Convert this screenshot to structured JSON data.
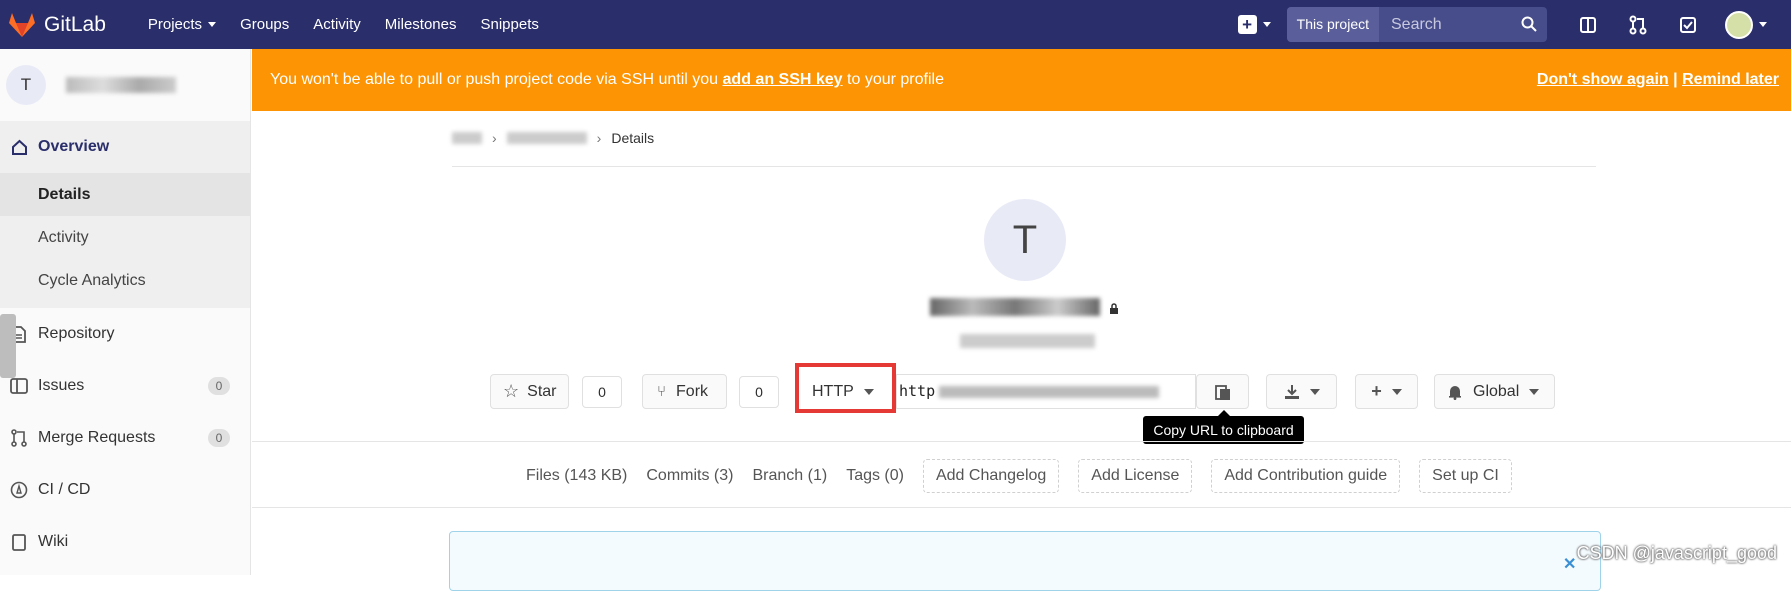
{
  "topnav": {
    "brand": "GitLab",
    "links": [
      "Projects",
      "Groups",
      "Activity",
      "Milestones",
      "Snippets"
    ],
    "search_scope": "This project",
    "search_placeholder": "Search"
  },
  "sidebar": {
    "project_avatar_letter": "T",
    "items": [
      {
        "label": "Overview"
      },
      {
        "label": "Details"
      },
      {
        "label": "Activity"
      },
      {
        "label": "Cycle Analytics"
      },
      {
        "label": "Repository"
      },
      {
        "label": "Issues",
        "count": "0"
      },
      {
        "label": "Merge Requests",
        "count": "0"
      },
      {
        "label": "CI / CD"
      },
      {
        "label": "Wiki"
      }
    ]
  },
  "banner": {
    "text_before": "You won't be able to pull or push project code via SSH until you ",
    "link": "add an SSH key",
    "text_after": " to your profile",
    "dont_show": "Don't show again",
    "separator": " | ",
    "remind": "Remind later"
  },
  "breadcrumb": {
    "current": "Details"
  },
  "project": {
    "avatar_letter": "T",
    "star_label": "Star",
    "star_count": "0",
    "fork_label": "Fork",
    "fork_count": "0",
    "protocol": "HTTP",
    "url_prefix": "http",
    "visibility": "Global",
    "tooltip": "Copy URL to clipboard"
  },
  "stats": {
    "files": "Files (143 KB)",
    "commits": "Commits (3)",
    "branch": "Branch (1)",
    "tags": "Tags (0)",
    "add_changelog": "Add Changelog",
    "add_license": "Add License",
    "add_contribution": "Add Contribution guide",
    "setup_ci": "Set up CI"
  },
  "watermark": "CSDN @javascript_good",
  "colors": {
    "nav": "#2a2e6b",
    "banner": "#fc9403",
    "highlight": "#e53935"
  }
}
